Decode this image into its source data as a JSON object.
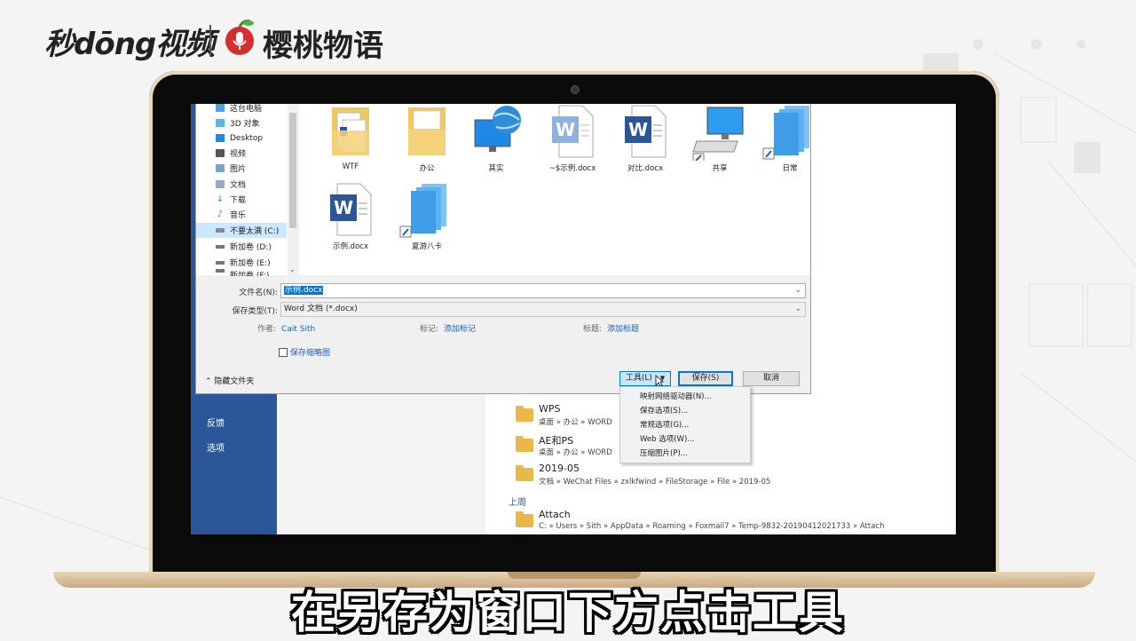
{
  "branding": {
    "logo_left": "秒dōng视频",
    "logo_right": "樱桃物语"
  },
  "word": {
    "sidebar": [
      "反馈",
      "选项"
    ],
    "recent": [
      {
        "name": "WPS",
        "path": "桌面 » 办公 » WORD"
      },
      {
        "name": "AE和PS",
        "path": "桌面 » 办公 » WORD"
      },
      {
        "name": "2019-05",
        "path": "文档 » WeChat Files » zxlkfwind » FileStorage » File » 2019-05"
      },
      {
        "name": "Attach",
        "path": "C: » Users » Sith » AppData » Roaming » Foxmail7 » Temp-9832-20190412021733 » Attach"
      }
    ],
    "section_last_week": "上周"
  },
  "dialog": {
    "nav": [
      "这台电脑",
      "3D 对象",
      "Desktop",
      "视频",
      "图片",
      "文档",
      "下载",
      "音乐",
      "不要太满 (C:)",
      "新加卷 (D:)",
      "新加卷 (E:)",
      "新加卷 (F:)"
    ],
    "files": [
      {
        "name": "WTF",
        "icon": "folder-doc-icon"
      },
      {
        "name": "办公",
        "icon": "folder-icon"
      },
      {
        "name": "其实",
        "icon": "network-globe-icon"
      },
      {
        "name": "~$示例.docx",
        "icon": "word-doc-icon"
      },
      {
        "name": "对比.docx",
        "icon": "word-doc-icon"
      },
      {
        "name": "共享",
        "icon": "computer-shortcut-icon"
      },
      {
        "name": "日常",
        "icon": "blue-stack-shortcut-icon"
      },
      {
        "name": "示例.docx",
        "icon": "word-doc-icon"
      },
      {
        "name": "夏游八卡",
        "icon": "blue-stack-shortcut-icon"
      }
    ],
    "filename_label": "文件名(N):",
    "filename_value": "示例.docx",
    "type_label": "保存类型(T):",
    "type_value": "Word 文档 (*.docx)",
    "author_label": "作者:",
    "author_value": "Cait Sith",
    "tags_label": "标记:",
    "tags_value": "添加标记",
    "title_label": "标题:",
    "title_value": "添加标题",
    "thumbnail_label": "保存缩略图",
    "hide_folders": "隐藏文件夹",
    "tools_button": "工具(L)",
    "save_button": "保存(S)",
    "cancel_button": "取消",
    "tools_menu": [
      "映射网络驱动器(N)...",
      "保存选项(S)...",
      "常规选项(G)...",
      "Web 选项(W)...",
      "压缩图片(P)..."
    ]
  },
  "caption": "在另存为窗口下方点击工具",
  "colors": {
    "word_blue": "#2b579a",
    "selection": "#0078d7",
    "folder": "#e8b84a"
  }
}
